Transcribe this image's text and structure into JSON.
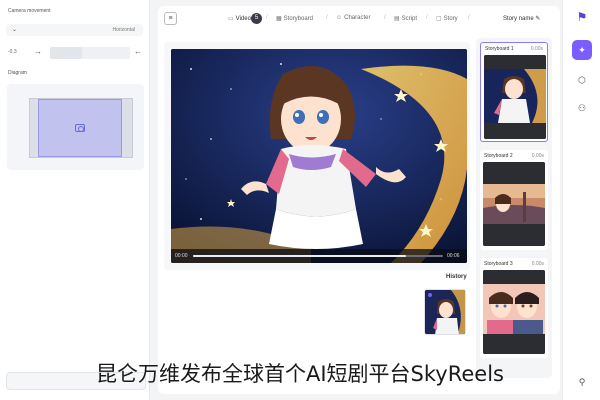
{
  "left_panel": {
    "camera_movement_label": "Camera movement",
    "camera_movement_value": "Horizontal",
    "slider_value": "-0.3",
    "slider_level": 0.4,
    "diagram_label": "Diagram"
  },
  "topbar": {
    "steps": [
      {
        "label": "Video",
        "num": "5"
      },
      {
        "label": "Storyboard"
      },
      {
        "label": "Character"
      },
      {
        "label": "Script"
      },
      {
        "label": "Story"
      }
    ],
    "story_name": "Story name"
  },
  "video": {
    "time_current": "00:00",
    "time_total": "00:06",
    "progress": 0.85
  },
  "history": {
    "title": "History"
  },
  "storyboards": [
    {
      "title": "Storyboard 1",
      "duration": "0.00s"
    },
    {
      "title": "Storyboard 2",
      "duration": "0.00s"
    },
    {
      "title": "Storyboard 3",
      "duration": "0.00s"
    }
  ],
  "caption": "昆仑万维发布全球首个AI短剧平台SkyReels",
  "colors": {
    "accent": "#7b5cff",
    "brand": "#5146d9"
  },
  "icons": [
    "menu-icon",
    "logo-icon",
    "magic-icon",
    "cube-icon",
    "share-icon",
    "user-icon",
    "camera-icon",
    "chevron-down-icon"
  ]
}
